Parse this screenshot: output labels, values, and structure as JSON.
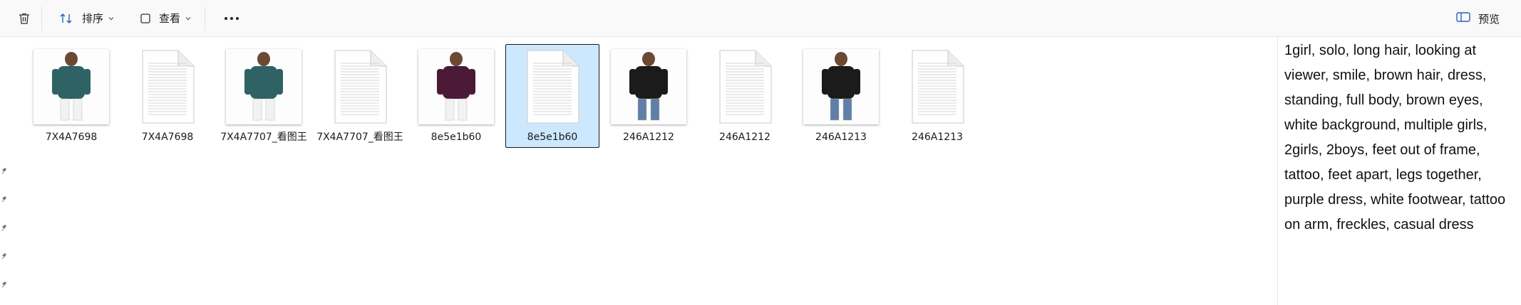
{
  "toolbar": {
    "delete_icon": "trash-icon",
    "sort_label": "排序",
    "sort_icon": "sort-arrows-icon",
    "view_label": "查看",
    "view_icon": "view-layout-icon",
    "more_icon": "ellipsis-icon",
    "preview_label": "预览",
    "preview_icon": "preview-pane-icon"
  },
  "files": [
    {
      "name": "7X4A7698",
      "kind": "image",
      "palette": [
        "#2e6264",
        "#f2f2f2"
      ]
    },
    {
      "name": "7X4A7698",
      "kind": "document"
    },
    {
      "name": "7X4A7707_看图王",
      "kind": "image",
      "palette": [
        "#2e6264",
        "#f2f2f2"
      ]
    },
    {
      "name": "7X4A7707_看图王",
      "kind": "document"
    },
    {
      "name": "8e5e1b60",
      "kind": "image",
      "palette": [
        "#4b1a37",
        "#f2f2f2"
      ]
    },
    {
      "name": "8e5e1b60",
      "kind": "document",
      "selected": true
    },
    {
      "name": "246A1212",
      "kind": "image",
      "palette": [
        "#1b1b1b",
        "#5f7fa6"
      ]
    },
    {
      "name": "246A1212",
      "kind": "document"
    },
    {
      "name": "246A1213",
      "kind": "image",
      "palette": [
        "#1b1b1b",
        "#5f7fa6"
      ]
    },
    {
      "name": "246A1213",
      "kind": "document"
    }
  ],
  "preview": {
    "text": "1girl, solo, long hair, looking at viewer, smile, brown hair, dress, standing, full body, brown eyes, white background, multiple girls, 2girls, 2boys, feet out of frame, tattoo, feet apart, legs together, purple dress, white footwear, tattoo on arm, freckles, casual dress"
  },
  "colors": {
    "selection": "#cce8ff",
    "toolbar_bg": "#f9f9f9",
    "accent": "#0067c0"
  }
}
